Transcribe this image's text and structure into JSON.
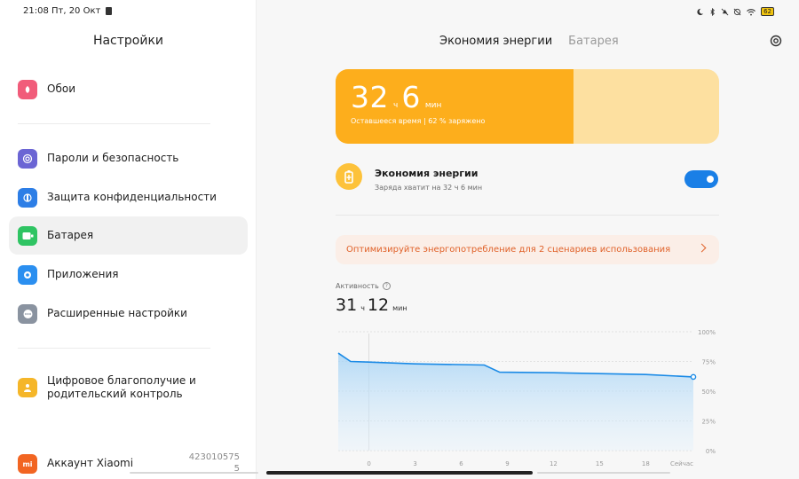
{
  "status_bar": {
    "time_date": "21:08 Пт, 20 Окт",
    "battery_badge": "62"
  },
  "sidebar": {
    "title": "Настройки",
    "items": [
      {
        "label": "Обои",
        "icon": "wallpaper-icon",
        "color": "#f15c7a"
      },
      {
        "label": "Пароли и безопасность",
        "icon": "fingerprint-icon",
        "color": "#6b65d4"
      },
      {
        "label": "Защита конфиденциальности",
        "icon": "privacy-icon",
        "color": "#2d7ee6"
      },
      {
        "label": "Батарея",
        "icon": "battery-icon",
        "color": "#2fc463"
      },
      {
        "label": "Приложения",
        "icon": "apps-gear-icon",
        "color": "#2b8ff0"
      },
      {
        "label": "Расширенные настройки",
        "icon": "more-dots-icon",
        "color": "#8a93a0"
      },
      {
        "label": "Цифровое благополучие и родительский контроль",
        "icon": "wellbeing-icon",
        "color": "#f5b629"
      },
      {
        "label": "Аккаунт Xiaomi",
        "icon": "mi-icon",
        "color": "#f26522"
      }
    ],
    "active_index": 3,
    "build_number_line1": "423010575",
    "build_number_line2": "5"
  },
  "main": {
    "tabs": [
      {
        "label": "Экономия энергии",
        "active": true
      },
      {
        "label": "Батарея",
        "active": false
      }
    ],
    "battery_card": {
      "hours": "32",
      "hours_unit": "ч",
      "minutes": "6",
      "minutes_unit": "мин",
      "subtitle": "Оставшееся время | 62 % заряжено",
      "charge_level_percent": 62,
      "fill_color": "#fdae1c"
    },
    "power_saver": {
      "title": "Экономия энергии",
      "subtitle": "Заряда хватит на 32 ч 6 мин",
      "enabled": true,
      "accent": "#1a7fe6"
    },
    "optimize_banner": {
      "text": "Оптимизируйте энергопотребление для 2 сценариев использования",
      "accent": "#e0622a"
    },
    "activity": {
      "label": "Активность",
      "hours": "31",
      "hours_unit": "ч",
      "minutes": "12",
      "minutes_unit": "мин"
    }
  },
  "chart_data": {
    "type": "area",
    "title": "",
    "xlabel": "",
    "ylabel": "",
    "x_ticks": [
      "0",
      "3",
      "6",
      "9",
      "12",
      "15",
      "18",
      "Сейчас"
    ],
    "y_ticks": [
      "100%",
      "75%",
      "50%",
      "25%",
      "0%"
    ],
    "ylim": [
      0,
      100
    ],
    "xlim": [
      -2,
      21.1
    ],
    "series": [
      {
        "values_x": [
          -2,
          -1.2,
          0,
          3,
          7.5,
          8.5,
          12,
          18,
          21.1
        ],
        "values_y": [
          82,
          75,
          74.5,
          73,
          72,
          66,
          65.5,
          64,
          62
        ]
      }
    ],
    "line_color": "#1a8ae6"
  }
}
